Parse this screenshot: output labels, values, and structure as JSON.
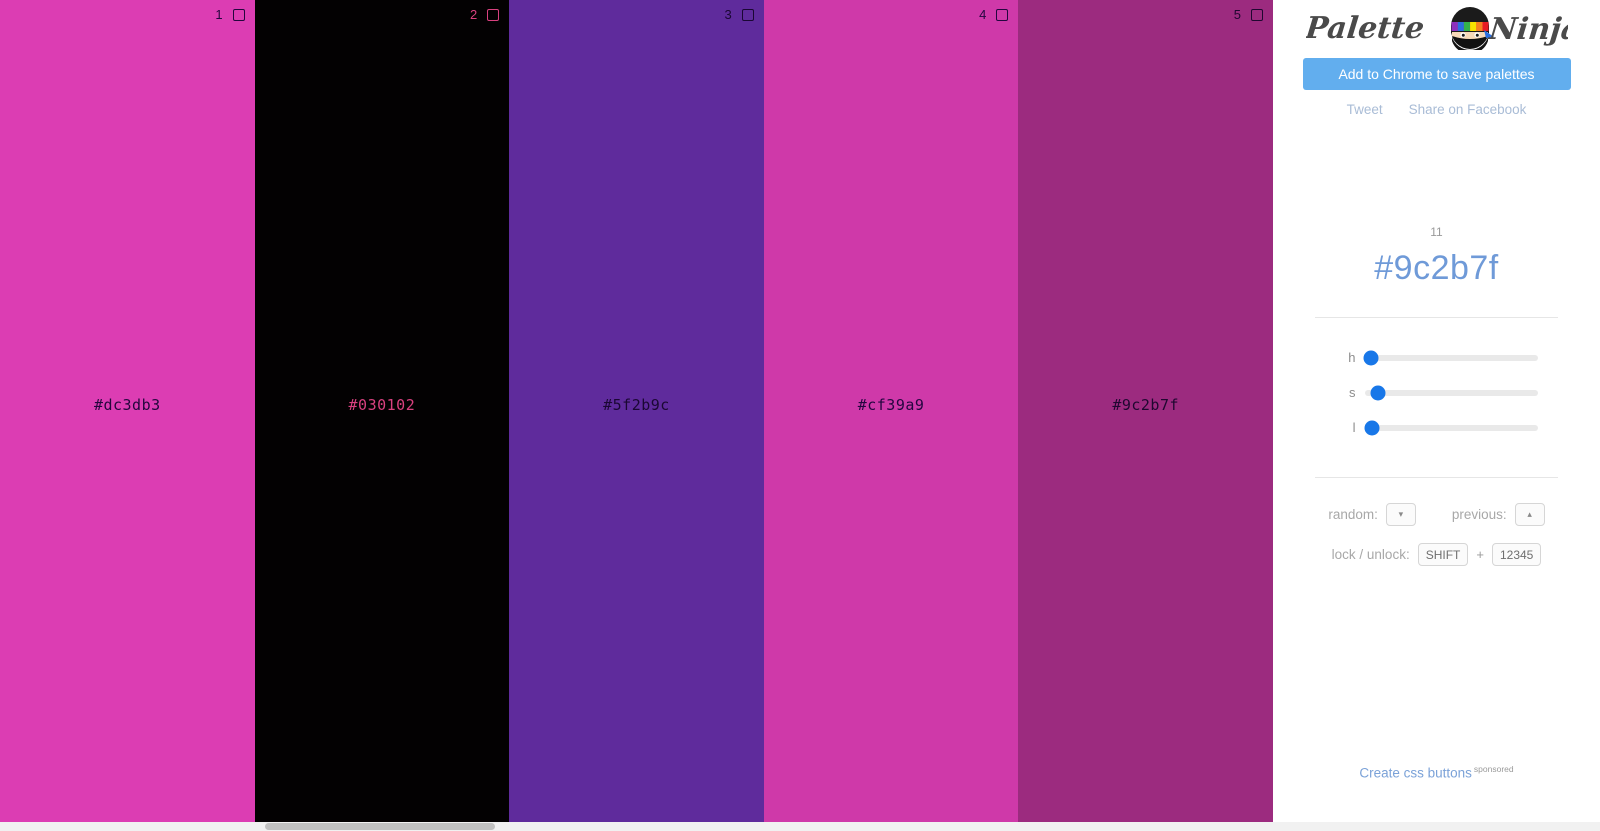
{
  "app": {
    "title": "Palette Ninja",
    "logo_word1": "Palette",
    "logo_word2": "Ninja"
  },
  "sidebar": {
    "cta_label": "Add to Chrome to save palettes",
    "social": [
      {
        "label": "Tweet",
        "name": "tweet-link"
      },
      {
        "label": "Share on Facebook",
        "name": "share-facebook-link"
      }
    ],
    "counter": "11",
    "selected_hex": "#9c2b7f",
    "sliders": [
      {
        "label": "h",
        "pos_pct": 4
      },
      {
        "label": "s",
        "pos_pct": 8
      },
      {
        "label": "l",
        "pos_pct": 4.5
      }
    ],
    "controls": {
      "random_label": "random:",
      "random_key": "▾",
      "previous_label": "previous:",
      "previous_key": "▴",
      "lock_label": "lock / unlock:",
      "lock_key": "SHIFT",
      "plus": "+",
      "lock_numbers": "12345"
    },
    "sponsor": {
      "label": "Create css buttons",
      "tag": "sponsored"
    }
  },
  "colors": {
    "accent_blue": "#62aeee",
    "hex_blue": "#6f9ad8",
    "slider_blue": "#1877e8"
  },
  "palette": [
    {
      "index": "1",
      "hex": "#dc3db3",
      "bg": "#dc3db3",
      "fg": "#23063d"
    },
    {
      "index": "2",
      "hex": "#030102",
      "bg": "#030102",
      "fg": "#d9417f"
    },
    {
      "index": "3",
      "hex": "#5f2b9c",
      "bg": "#5f2b9c",
      "fg": "#1a0733"
    },
    {
      "index": "4",
      "hex": "#cf39a9",
      "bg": "#cf39a9",
      "fg": "#230640"
    },
    {
      "index": "5",
      "hex": "#9c2b7f",
      "bg": "#9c2b7f",
      "fg": "#1f0730"
    }
  ]
}
